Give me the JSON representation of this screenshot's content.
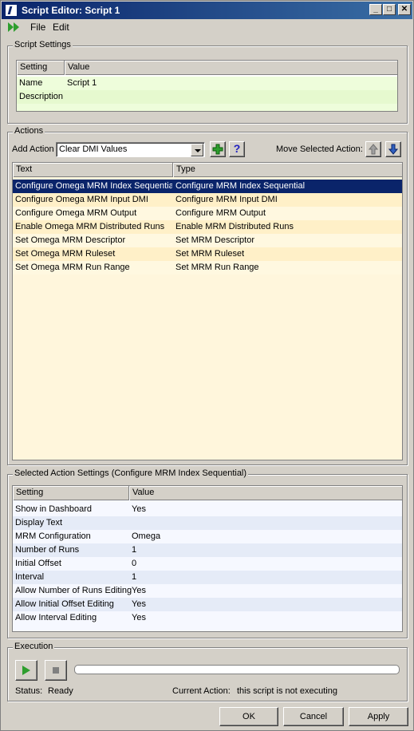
{
  "window": {
    "title": "Script Editor: Script 1"
  },
  "menu": {
    "file": "File",
    "edit": "Edit"
  },
  "script_settings": {
    "title": "Script Settings",
    "columns": [
      "Setting",
      "Value"
    ],
    "rows": [
      {
        "setting": "Name",
        "value": "Script 1"
      },
      {
        "setting": "Description",
        "value": ""
      }
    ]
  },
  "actions": {
    "title": "Actions",
    "add_action_label": "Add Action",
    "add_action_selected": "Clear DMI Values",
    "move_label": "Move Selected Action:",
    "columns": [
      "Text",
      "Type"
    ],
    "rows": [
      {
        "text": "Configure Omega MRM Index Sequential",
        "type": "Configure MRM Index Sequential"
      },
      {
        "text": "Configure Omega MRM Input DMI",
        "type": "Configure MRM Input DMI"
      },
      {
        "text": "Configure Omega MRM Output",
        "type": "Configure MRM Output"
      },
      {
        "text": "Enable Omega MRM Distributed Runs",
        "type": "Enable MRM Distributed Runs"
      },
      {
        "text": "Set Omega MRM Descriptor",
        "type": "Set MRM Descriptor"
      },
      {
        "text": "Set Omega MRM Ruleset",
        "type": "Set MRM Ruleset"
      },
      {
        "text": "Set Omega MRM Run Range",
        "type": "Set MRM Run Range"
      }
    ]
  },
  "selected_settings": {
    "title": "Selected Action Settings (Configure MRM Index Sequential)",
    "columns": [
      "Setting",
      "Value"
    ],
    "rows": [
      {
        "setting": "Show in Dashboard",
        "value": "Yes"
      },
      {
        "setting": "Display Text",
        "value": ""
      },
      {
        "setting": "MRM Configuration",
        "value": "Omega"
      },
      {
        "setting": "Number of Runs",
        "value": "1"
      },
      {
        "setting": "Initial Offset",
        "value": "0"
      },
      {
        "setting": "Interval",
        "value": "1"
      },
      {
        "setting": "Allow Number of Runs Editing",
        "value": "Yes"
      },
      {
        "setting": "Allow Initial Offset Editing",
        "value": "Yes"
      },
      {
        "setting": "Allow Interval Editing",
        "value": "Yes"
      }
    ]
  },
  "execution": {
    "title": "Execution",
    "status_label": "Status:",
    "status_value": "Ready",
    "current_action_label": "Current Action:",
    "current_action_value": "this script is not executing",
    "progress": 0
  },
  "buttons": {
    "ok": "OK",
    "cancel": "Cancel",
    "apply": "Apply"
  },
  "colors": {
    "title_bar": "#0a246a",
    "selection": "#0a246a",
    "add_green": "#2e9e2e",
    "help_blue": "#2020c0"
  }
}
